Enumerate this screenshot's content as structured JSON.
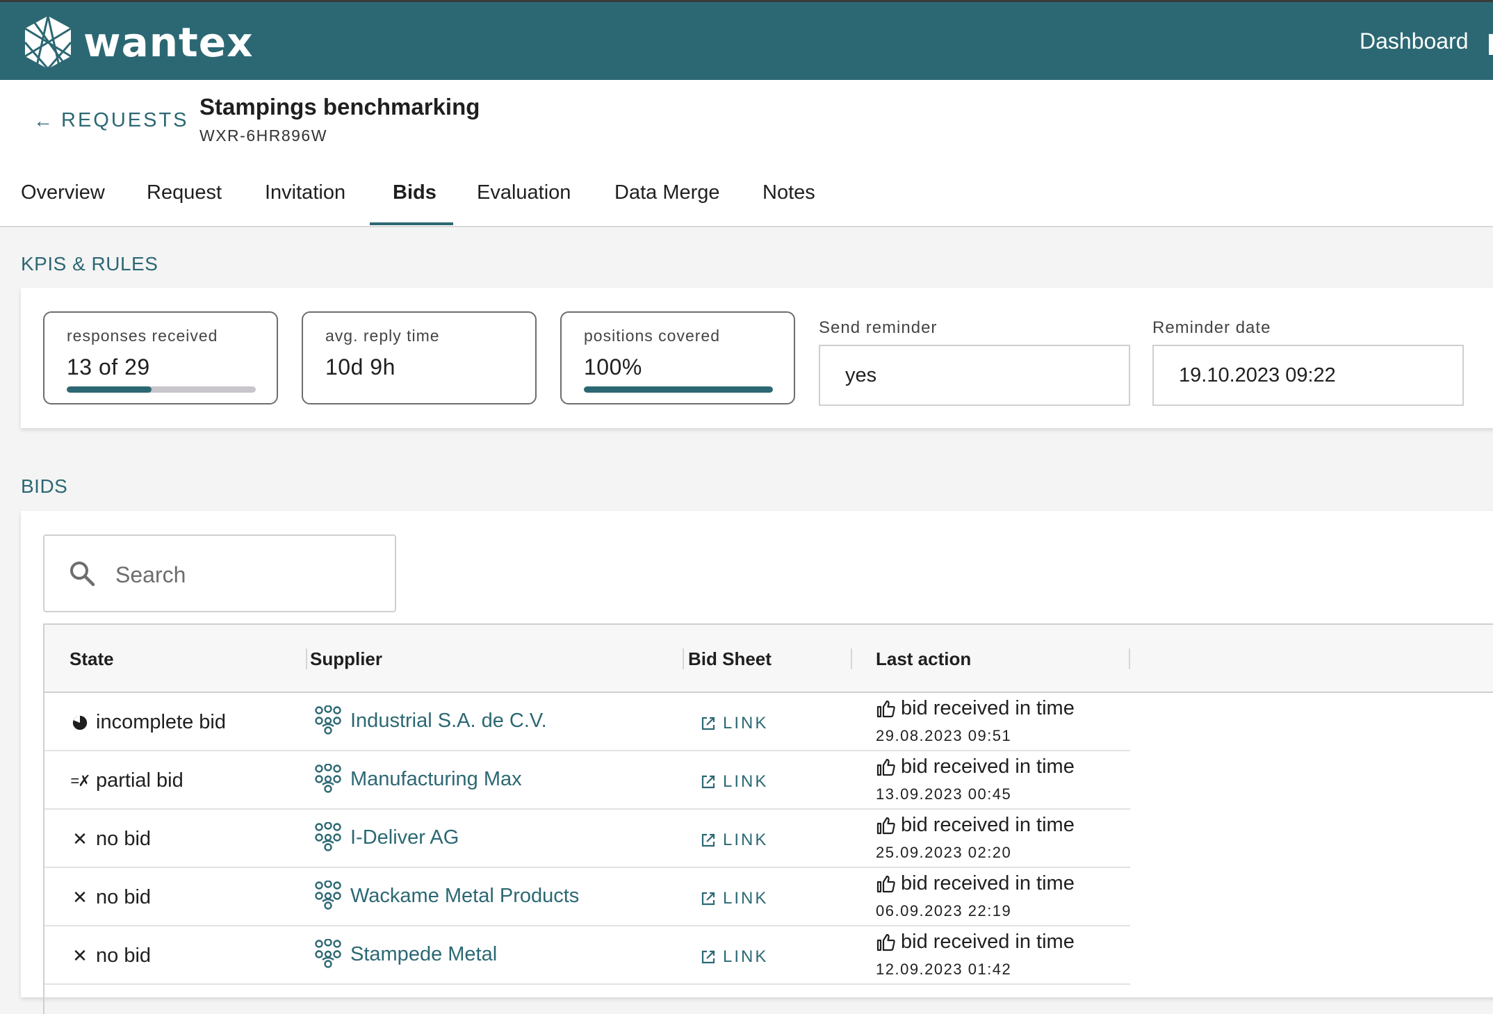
{
  "app": {
    "brand": "wantex",
    "nav_dashboard": "Dashboard"
  },
  "header": {
    "back_label": "REQUESTS",
    "title": "Stampings benchmarking",
    "code": "WXR-6HR896W"
  },
  "tabs": [
    {
      "label": "Overview"
    },
    {
      "label": "Request"
    },
    {
      "label": "Invitation"
    },
    {
      "label": "Bids",
      "active": true
    },
    {
      "label": "Evaluation"
    },
    {
      "label": "Data Merge"
    },
    {
      "label": "Notes"
    }
  ],
  "kpis": {
    "section_title": "KPIS & RULES",
    "responses": {
      "label": "responses received",
      "value": "13 of 29",
      "progress": 0.45
    },
    "reply_time": {
      "label": "avg. reply time",
      "value": "10d 9h"
    },
    "positions": {
      "label": "positions covered",
      "value": "100%",
      "progress": 1.0
    },
    "send_reminder": {
      "label": "Send reminder",
      "value": "yes"
    },
    "reminder_date": {
      "label": "Reminder date",
      "value": "19.10.2023 09:22"
    }
  },
  "bids": {
    "section_title": "BIDS",
    "search_placeholder": "Search",
    "columns": {
      "state": "State",
      "supplier": "Supplier",
      "bid_sheet": "Bid Sheet",
      "last_action": "Last action"
    },
    "rows": [
      {
        "state": "incomplete bid",
        "state_icon": "pie-icon",
        "supplier": "Industrial S.A. de C.V.",
        "link": "LINK",
        "action": "bid received in time",
        "time": "29.08.2023 09:51"
      },
      {
        "state": "partial bid",
        "state_icon": "partial-icon",
        "supplier": "Manufacturing Max",
        "link": "LINK",
        "action": "bid received in time",
        "time": "13.09.2023 00:45"
      },
      {
        "state": "no bid",
        "state_icon": "close-icon",
        "supplier": "I-Deliver AG",
        "link": "LINK",
        "action": "bid received in time",
        "time": "25.09.2023 02:20"
      },
      {
        "state": "no bid",
        "state_icon": "close-icon",
        "supplier": "Wackame Metal Products",
        "link": "LINK",
        "action": "bid received in time",
        "time": "06.09.2023 22:19"
      },
      {
        "state": "no bid",
        "state_icon": "close-icon",
        "supplier": "Stampede Metal",
        "link": "LINK",
        "action": "bid received in time",
        "time": "12.09.2023 01:42"
      }
    ]
  },
  "colors": {
    "brand": "#2c6873",
    "bar_track": "#c9c5cc"
  }
}
